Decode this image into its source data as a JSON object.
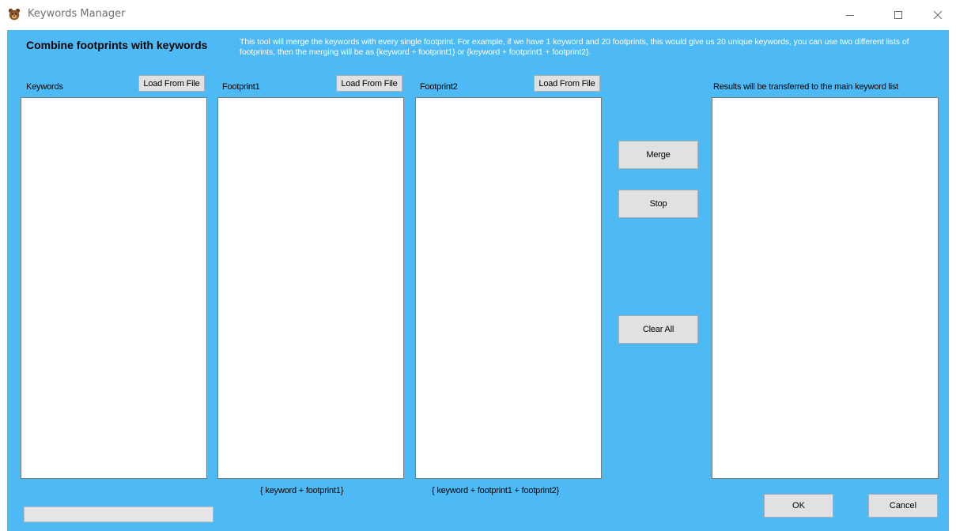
{
  "window": {
    "title": "Keywords Manager",
    "icon": "bear-icon"
  },
  "header": {
    "title": "Combine footprints with keywords",
    "description": "This tool will merge the keywords with every single footprint. For example, if we have 1 keyword and 20 footprints, this would give us 20 unique keywords, you can use two different lists of footprints, then the merging will be as {keyword + footprint1} or {keyword + footprint1 + footprint2}."
  },
  "columns": {
    "keywords": {
      "label": "Keywords",
      "load_label": "Load From File",
      "items": []
    },
    "footprint1": {
      "label": "Footprint1",
      "load_label": "Load From File",
      "items": [],
      "formula": "{ keyword + footprint1}"
    },
    "footprint2": {
      "label": "Footprint2",
      "load_label": "Load From File",
      "items": [],
      "formula": "{ keyword + footprint1 + footprint2}"
    },
    "results": {
      "label": "Results will be transferred to the main keyword list",
      "items": []
    }
  },
  "actions": {
    "merge_label": "Merge",
    "stop_label": "Stop",
    "clear_label": "Clear All"
  },
  "dialog": {
    "ok_label": "OK",
    "cancel_label": "Cancel"
  },
  "progress": {
    "value": 0
  },
  "colors": {
    "background": "#4dbaf5",
    "button": "#e1e1e1",
    "description_text": "#ffffff"
  }
}
